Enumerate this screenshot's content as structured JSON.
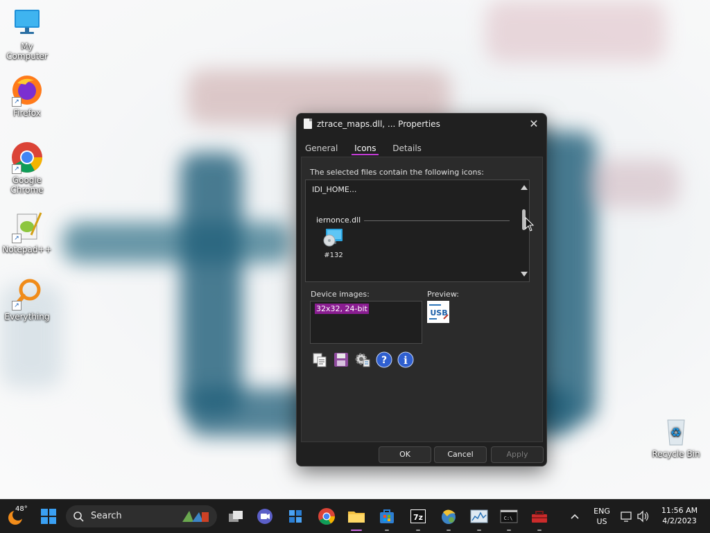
{
  "desktop": {
    "icons": [
      {
        "label": "My Computer"
      },
      {
        "label": "Firefox"
      },
      {
        "label": "Google Chrome"
      },
      {
        "label": "Notepad++"
      },
      {
        "label": "Everything"
      },
      {
        "label": "Recycle Bin"
      }
    ]
  },
  "dialog": {
    "title": "ztrace_maps.dll, ... Properties",
    "close_glyph": "✕",
    "tabs": [
      {
        "label": "General",
        "active": false
      },
      {
        "label": "Icons",
        "active": true
      },
      {
        "label": "Details",
        "active": false
      }
    ],
    "icons_label": "The selected files contain the following icons:",
    "list": {
      "first_item": "IDI_HOME...",
      "group_name": "iernonce.dll",
      "icon_label": "#132"
    },
    "device_images_label": "Device images:",
    "device_images": [
      "32x32, 24-bit"
    ],
    "preview_label": "Preview:",
    "preview_text": "USB",
    "toolbar_icons": [
      "copy-icon",
      "save-icon",
      "settings-icon",
      "help-icon",
      "info-icon"
    ],
    "buttons": {
      "ok": "OK",
      "cancel": "Cancel",
      "apply": "Apply"
    }
  },
  "taskbar": {
    "weather_temp": "48°",
    "search_placeholder": "Search",
    "tray": {
      "lang_line1": "ENG",
      "lang_line2": "US",
      "time": "11:56 AM",
      "date": "4/2/2023"
    }
  },
  "colors": {
    "accent": "#c43bd6",
    "selection": "#8a1d91",
    "dialog_bg": "#202020"
  }
}
